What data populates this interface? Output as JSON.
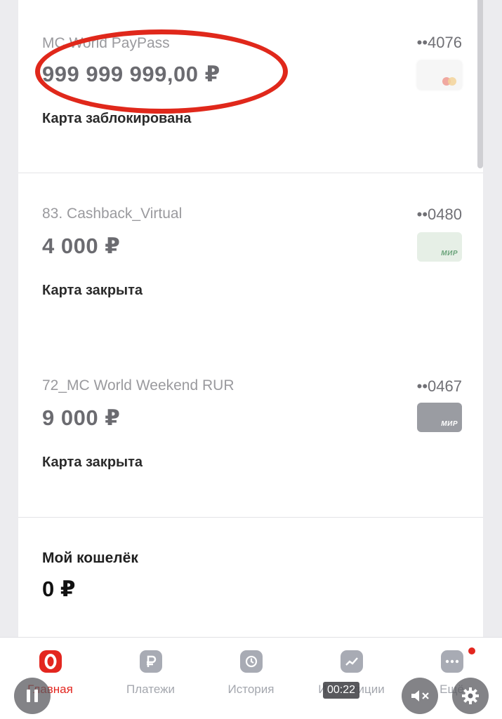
{
  "cards": [
    {
      "name": "MC World PayPass",
      "amount": "999 999 999,00 ₽",
      "status": "Карта заблокирована",
      "number": "••4076",
      "thumb": "mastercard"
    },
    {
      "name": "83. Cashback_Virtual",
      "amount": "4 000 ₽",
      "status": "Карта закрыта",
      "number": "••0480",
      "thumb": "mir",
      "thumb_label": "МИР"
    },
    {
      "name": "72_MC World Weekend RUR",
      "amount": "9 000 ₽",
      "status": "Карта закрыта",
      "number": "••0467",
      "thumb": "mir",
      "thumb_label": "МИР"
    }
  ],
  "wallet": {
    "title": "Мой кошелёк",
    "amount": "0 ₽"
  },
  "tabbar": [
    {
      "label": "Главная",
      "icon": "home-logo-icon",
      "active": true
    },
    {
      "label": "Платежи",
      "icon": "payments-icon",
      "active": false
    },
    {
      "label": "История",
      "icon": "clock-icon",
      "active": false
    },
    {
      "label": "Инвестиции",
      "icon": "chart-icon",
      "active": false
    },
    {
      "label": "Ещё",
      "icon": "more-icon",
      "active": false
    }
  ],
  "video_overlay": {
    "time": "00:22",
    "pause_icon": "pause-icon",
    "mute_icon": "mute-icon",
    "settings_icon": "gear-icon"
  },
  "colors": {
    "accent": "#e3261f",
    "highlight_circle": "#e0281b"
  }
}
